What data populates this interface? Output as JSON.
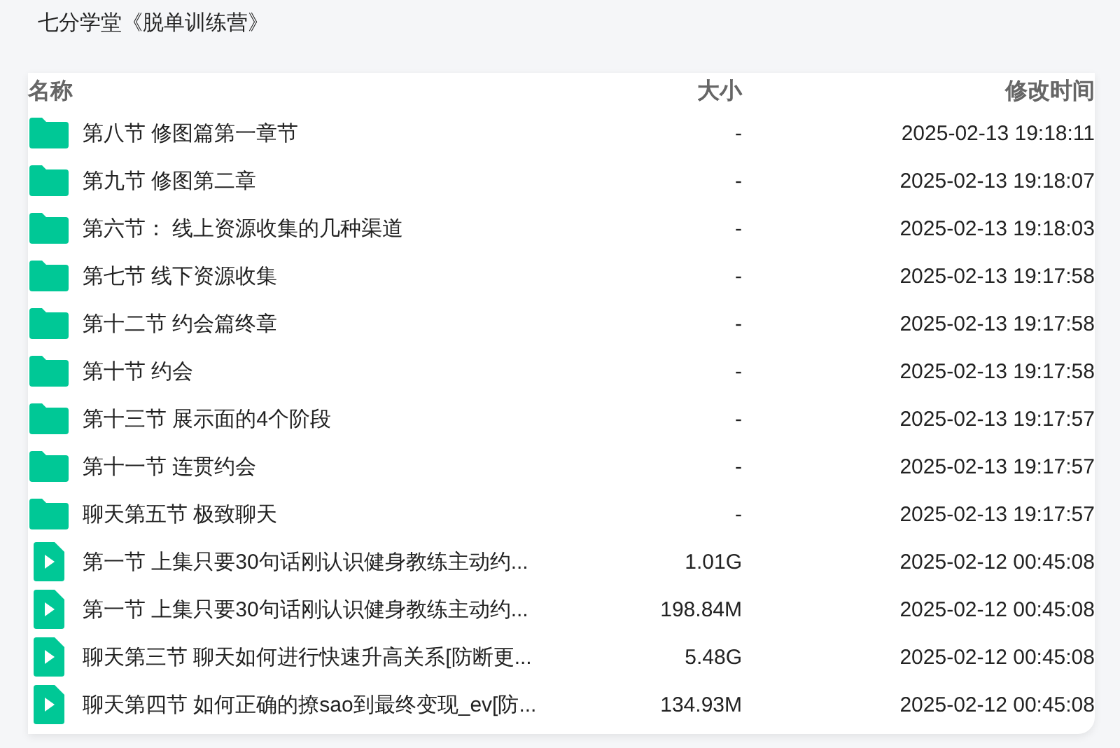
{
  "title": "七分学堂《脱单训练营》",
  "table": {
    "columns": [
      "名称",
      "大小",
      "修改时间"
    ],
    "rows": [
      {
        "kind": "folder",
        "name": "第八节 修图篇第一章节",
        "size": "-",
        "modified": "2025-02-13 19:18:11"
      },
      {
        "kind": "folder",
        "name": "第九节 修图第二章",
        "size": "-",
        "modified": "2025-02-13 19:18:07"
      },
      {
        "kind": "folder",
        "name": "第六节：  线上资源收集的几种渠道",
        "size": "-",
        "modified": "2025-02-13 19:18:03"
      },
      {
        "kind": "folder",
        "name": "第七节 线下资源收集",
        "size": "-",
        "modified": "2025-02-13 19:17:58"
      },
      {
        "kind": "folder",
        "name": "第十二节 约会篇终章",
        "size": "-",
        "modified": "2025-02-13 19:17:58"
      },
      {
        "kind": "folder",
        "name": "第十节 约会",
        "size": "-",
        "modified": "2025-02-13 19:17:58"
      },
      {
        "kind": "folder",
        "name": "第十三节 展示面的4个阶段",
        "size": "-",
        "modified": "2025-02-13 19:17:57"
      },
      {
        "kind": "folder",
        "name": "第十一节 连贯约会",
        "size": "-",
        "modified": "2025-02-13 19:17:57"
      },
      {
        "kind": "folder",
        "name": "聊天第五节 极致聊天",
        "size": "-",
        "modified": "2025-02-13 19:17:57"
      },
      {
        "kind": "video",
        "name": "第一节 上集只要30句话刚认识健身教练主动约...",
        "size": "1.01G",
        "modified": "2025-02-12 00:45:08"
      },
      {
        "kind": "video",
        "name": "第一节 上集只要30句话刚认识健身教练主动约...",
        "size": "198.84M",
        "modified": "2025-02-12 00:45:08"
      },
      {
        "kind": "video",
        "name": "聊天第三节 聊天如何进行快速升高关系[防断更...",
        "size": "5.48G",
        "modified": "2025-02-12 00:45:08"
      },
      {
        "kind": "video",
        "name": "聊天第四节 如何正确的撩sao到最终变现_ev[防...",
        "size": "134.93M",
        "modified": "2025-02-12 00:45:08"
      }
    ]
  }
}
